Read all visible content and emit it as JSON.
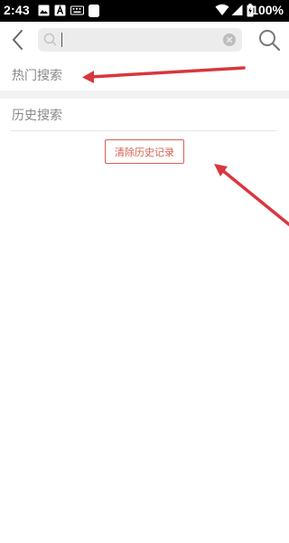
{
  "status_bar": {
    "time": "2:43",
    "battery_text": "100%",
    "icons": [
      "image-icon",
      "a-icon",
      "keyboard-icon",
      "app-icon",
      "wifi-icon",
      "signal-icon",
      "battery-icon"
    ]
  },
  "search": {
    "placeholder": "",
    "value": "",
    "back_icon": "back-arrow-icon",
    "clear_icon": "clear-circle-icon",
    "submit_icon": "search-icon"
  },
  "hot_search": {
    "title": "热门搜索"
  },
  "history": {
    "title": "历史搜索",
    "clear_button_label": "清除历史记录"
  },
  "colors": {
    "accent": "#d9604f",
    "annotation_arrow": "#d9363e",
    "section_gray": "#f2f2f4",
    "search_box_bg": "#ececec"
  }
}
